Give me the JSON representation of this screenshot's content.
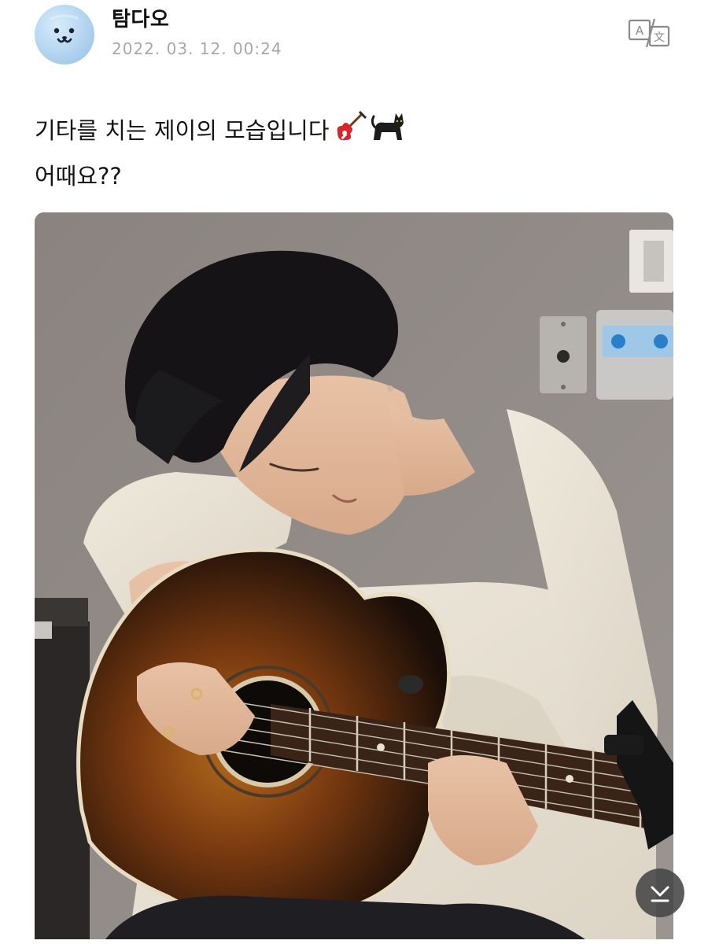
{
  "post": {
    "author": "탐다오",
    "date": "2022. 03. 12. 00:24",
    "lines": [
      "기타를 치는 제이의 모습입니다",
      "어때요??"
    ],
    "line1_emojis": [
      "guitar-emoji",
      "black-cat-emoji"
    ]
  },
  "icons": {
    "translate": "translate-icon",
    "scroll_down": "chevron-down-icon",
    "avatar": "avatar-face-icon"
  },
  "colors": {
    "date_text": "#a7a7a7",
    "body_text": "#141414",
    "scroll_button": "#464646",
    "avatar_bg": "#b9d8f2"
  }
}
